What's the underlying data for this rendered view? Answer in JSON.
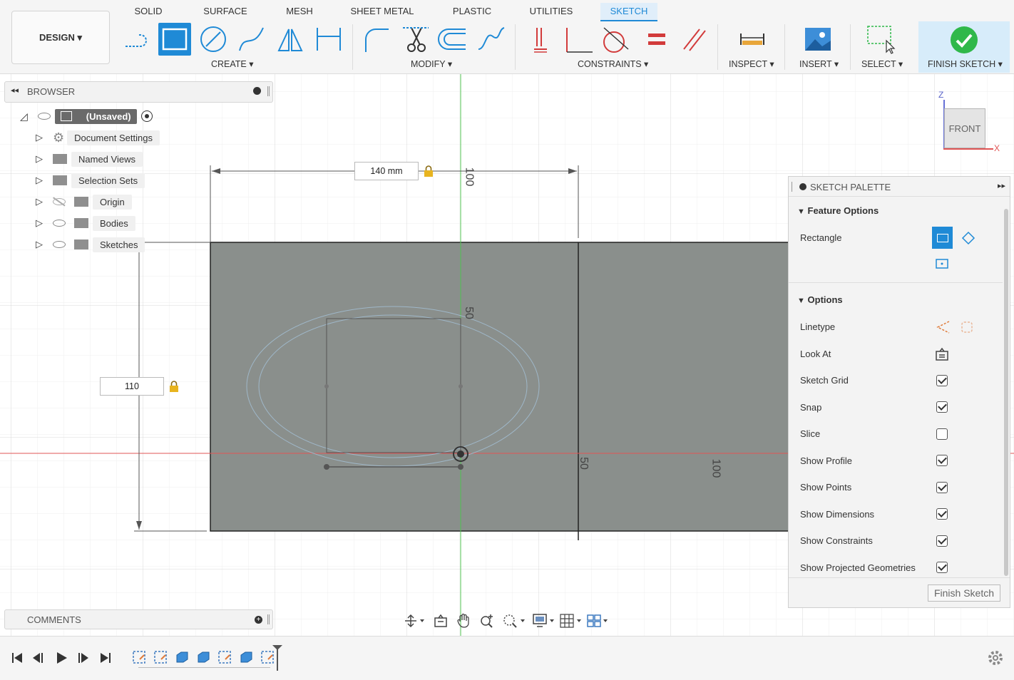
{
  "workspace": {
    "label": "DESIGN ▾"
  },
  "tabs": [
    {
      "label": "SOLID"
    },
    {
      "label": "SURFACE"
    },
    {
      "label": "MESH"
    },
    {
      "label": "SHEET METAL"
    },
    {
      "label": "PLASTIC"
    },
    {
      "label": "UTILITIES"
    },
    {
      "label": "SKETCH",
      "active": true
    }
  ],
  "groups": {
    "create": "CREATE ▾",
    "modify": "MODIFY ▾",
    "constraints": "CONSTRAINTS ▾",
    "inspect": "INSPECT ▾",
    "insert": "INSERT ▾",
    "select": "SELECT ▾",
    "finish": "FINISH SKETCH ▾"
  },
  "browser": {
    "title": "BROWSER",
    "root": "(Unsaved)",
    "items": [
      {
        "label": "Document Settings",
        "icon": "gear-icon"
      },
      {
        "label": "Named Views",
        "icon": "folder-icon"
      },
      {
        "label": "Selection Sets",
        "icon": "folder-icon"
      },
      {
        "label": "Origin",
        "icon": "folder-icon",
        "eye": "hidden"
      },
      {
        "label": "Bodies",
        "icon": "folder-icon",
        "eye": "visible"
      },
      {
        "label": "Sketches",
        "icon": "folder-icon",
        "eye": "visible"
      }
    ]
  },
  "comments": {
    "title": "COMMENTS"
  },
  "viewcube": {
    "face": "FRONT",
    "axis_z": "Z",
    "axis_x": "X"
  },
  "sketch": {
    "dim_width": "140 mm",
    "dim_height": "110",
    "grid_label_top_100": "100",
    "grid_label_50_top": "50",
    "grid_label_50_right": "50",
    "grid_label_100_right": "100"
  },
  "palette": {
    "title": "SKETCH PALETTE",
    "feature_options": "Feature Options",
    "rectangle_label": "Rectangle",
    "options_title": "Options",
    "options": [
      {
        "label": "Linetype",
        "type": "icons"
      },
      {
        "label": "Look At",
        "type": "icon"
      },
      {
        "label": "Sketch Grid",
        "checked": true
      },
      {
        "label": "Snap",
        "checked": true
      },
      {
        "label": "Slice",
        "checked": false
      },
      {
        "label": "Show Profile",
        "checked": true
      },
      {
        "label": "Show Points",
        "checked": true
      },
      {
        "label": "Show Dimensions",
        "checked": true
      },
      {
        "label": "Show Constraints",
        "checked": true
      },
      {
        "label": "Show Projected Geometries",
        "checked": true
      }
    ],
    "finish_button": "Finish Sketch"
  },
  "colors": {
    "accent": "#1f8ad6",
    "profile_fill": "#8a8f8c",
    "x_axis": "#e05555",
    "y_axis": "#4fc04f",
    "finish_check": "#2fb84a"
  }
}
